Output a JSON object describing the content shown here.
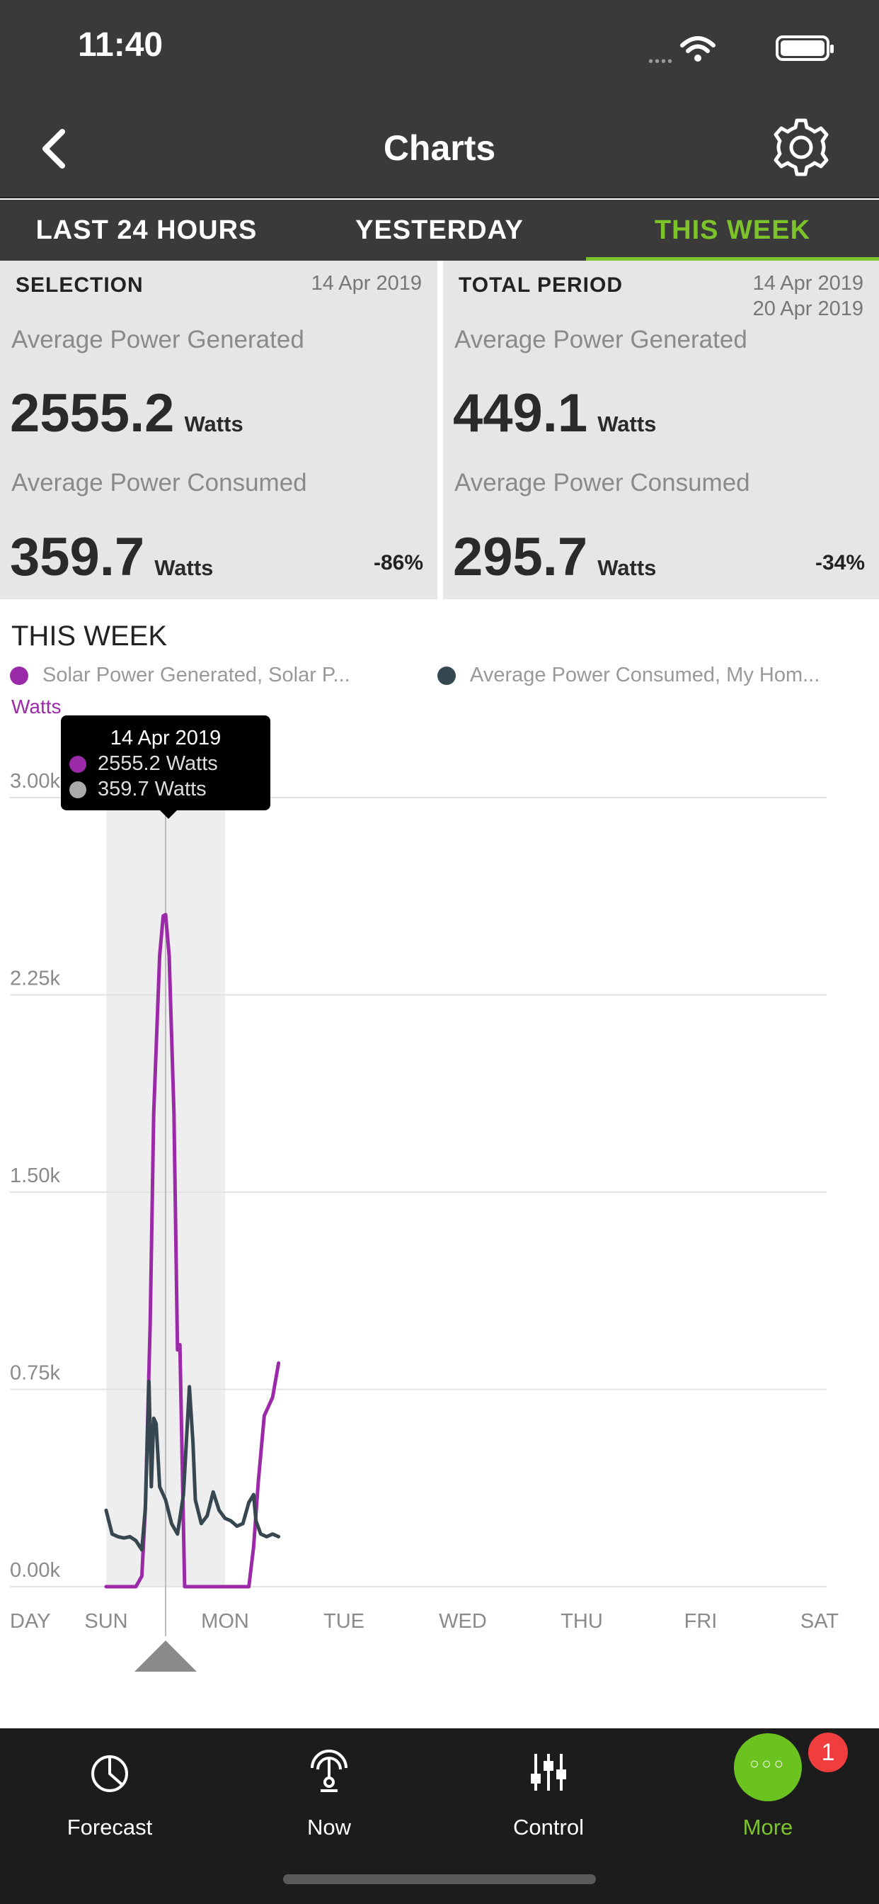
{
  "status_bar": {
    "time": "11:40"
  },
  "nav": {
    "title": "Charts"
  },
  "tabs": [
    {
      "label": "LAST 24 HOURS",
      "active": false
    },
    {
      "label": "YESTERDAY",
      "active": false
    },
    {
      "label": "THIS WEEK",
      "active": true
    }
  ],
  "selection": {
    "heading": "SELECTION",
    "date": "14 Apr 2019",
    "generated_label": "Average Power Generated",
    "generated_value": "2555.2",
    "generated_unit": "Watts",
    "consumed_label": "Average Power Consumed",
    "consumed_value": "359.7",
    "consumed_unit": "Watts",
    "consumed_pct": "-86%"
  },
  "total_period": {
    "heading": "TOTAL PERIOD",
    "date_start": "14 Apr 2019",
    "date_end": "20 Apr 2019",
    "generated_label": "Average Power Generated",
    "generated_value": "449.1",
    "generated_unit": "Watts",
    "consumed_label": "Average Power Consumed",
    "consumed_value": "295.7",
    "consumed_unit": "Watts",
    "consumed_pct": "-34%"
  },
  "chart": {
    "title": "THIS WEEK",
    "legend": [
      {
        "label": "Solar Power Generated, Solar P...",
        "color": "#9b2aa8"
      },
      {
        "label": "Average Power Consumed, My Hom...",
        "color": "#37474f"
      }
    ],
    "y_unit": "Watts"
  },
  "tooltip": {
    "date": "14 Apr 2019",
    "generated": "2555.2 Watts",
    "consumed": "359.7 Watts"
  },
  "chart_data": {
    "type": "line",
    "title": "THIS WEEK",
    "xlabel": "DAY",
    "ylabel": "Watts",
    "ylim": [
      0,
      3000
    ],
    "y_ticks": [
      "3.00k",
      "2.25k",
      "1.50k",
      "0.75k",
      "0.00k"
    ],
    "y_tick_values": [
      3000,
      2250,
      1500,
      750,
      0
    ],
    "x_ticks": [
      "SUN",
      "MON",
      "TUE",
      "WED",
      "THU",
      "FRI",
      "SAT"
    ],
    "x_tick_values": [
      0,
      1,
      2,
      3,
      4,
      5,
      6
    ],
    "grid": true,
    "selected_range": [
      0,
      1
    ],
    "selected_x": 0.5,
    "series": [
      {
        "name": "Solar Power Generated, Solar P...",
        "color": "#9b2aa8",
        "x": [
          0,
          0.25,
          0.3,
          0.33,
          0.37,
          0.4,
          0.45,
          0.48,
          0.5,
          0.53,
          0.57,
          0.6,
          0.62,
          0.66,
          0.7,
          0.8,
          0.9,
          1.0,
          1.1,
          1.2,
          1.24,
          1.28,
          1.33,
          1.36,
          1.4,
          1.45
        ],
        "values": [
          0,
          0,
          40,
          300,
          1000,
          1800,
          2400,
          2550,
          2555,
          2400,
          1800,
          900,
          920,
          0,
          0,
          0,
          0,
          0,
          0,
          0,
          150,
          400,
          650,
          680,
          720,
          850
        ]
      },
      {
        "name": "Average Power Consumed, My Hom...",
        "color": "#37474f",
        "x": [
          0,
          0.05,
          0.1,
          0.15,
          0.2,
          0.25,
          0.3,
          0.33,
          0.36,
          0.38,
          0.4,
          0.42,
          0.45,
          0.5,
          0.55,
          0.6,
          0.65,
          0.7,
          0.73,
          0.75,
          0.8,
          0.85,
          0.9,
          0.95,
          1.0,
          1.05,
          1.1,
          1.15,
          1.2,
          1.24,
          1.26,
          1.3,
          1.35,
          1.4,
          1.45
        ],
        "values": [
          290,
          200,
          190,
          185,
          190,
          175,
          140,
          300,
          780,
          380,
          640,
          620,
          380,
          330,
          240,
          200,
          350,
          760,
          550,
          330,
          240,
          270,
          360,
          290,
          260,
          250,
          230,
          240,
          320,
          350,
          250,
          200,
          190,
          200,
          190
        ]
      }
    ]
  },
  "tabbar": {
    "items": [
      {
        "label": "Forecast",
        "icon": "forecast-icon"
      },
      {
        "label": "Now",
        "icon": "gauge-icon"
      },
      {
        "label": "Control",
        "icon": "sliders-icon"
      },
      {
        "label": "More",
        "icon": "more-icon",
        "active": true
      }
    ],
    "badge": "1",
    "accent_color": "#7dc42b"
  }
}
